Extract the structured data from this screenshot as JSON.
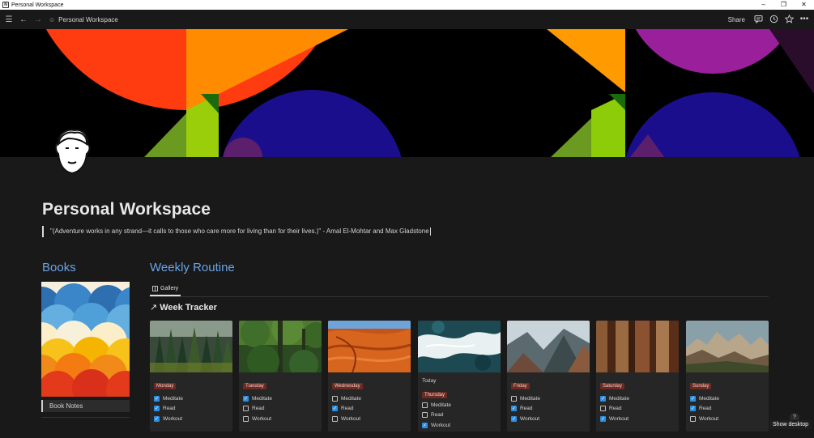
{
  "window": {
    "title": "Personal Workspace",
    "controls": {
      "minimize": "–",
      "restore": "❐",
      "close": "✕"
    }
  },
  "toolbar": {
    "breadcrumb": "Personal Workspace",
    "share_label": "Share"
  },
  "page": {
    "title": "Personal Workspace",
    "quote": "\"(Adventure works in any strand—it calls to those who care more for living than for their lives.)\" - Amal El-Mohtar and Max Gladstone"
  },
  "books": {
    "heading": "Books",
    "card_title": "Book Notes"
  },
  "weekly": {
    "heading": "Weekly Routine",
    "view_tab": "Gallery",
    "tracker_title": "Week Tracker",
    "cards": [
      {
        "day": "Monday",
        "today": "",
        "tasks": [
          {
            "label": "Meditate",
            "done": true
          },
          {
            "label": "Read",
            "done": true
          },
          {
            "label": "Workout",
            "done": true
          }
        ]
      },
      {
        "day": "Tuesday",
        "today": "",
        "tasks": [
          {
            "label": "Meditate",
            "done": true
          },
          {
            "label": "Read",
            "done": false
          },
          {
            "label": "Workout",
            "done": false
          }
        ]
      },
      {
        "day": "Wednesday",
        "today": "",
        "tasks": [
          {
            "label": "Meditate",
            "done": false
          },
          {
            "label": "Read",
            "done": true
          },
          {
            "label": "Workout",
            "done": false
          }
        ]
      },
      {
        "day": "Thursday",
        "today": "Today",
        "tasks": [
          {
            "label": "Meditate",
            "done": false
          },
          {
            "label": "Read",
            "done": false
          },
          {
            "label": "Workout",
            "done": true
          }
        ]
      },
      {
        "day": "Friday",
        "today": "",
        "tasks": [
          {
            "label": "Meditate",
            "done": false
          },
          {
            "label": "Read",
            "done": true
          },
          {
            "label": "Workout",
            "done": true
          }
        ]
      },
      {
        "day": "Saturday",
        "today": "",
        "tasks": [
          {
            "label": "Meditate",
            "done": true
          },
          {
            "label": "Read",
            "done": false
          },
          {
            "label": "Workout",
            "done": true
          }
        ]
      },
      {
        "day": "Sunday",
        "today": "",
        "tasks": [
          {
            "label": "Meditate",
            "done": true
          },
          {
            "label": "Read",
            "done": true
          },
          {
            "label": "Workout",
            "done": false
          }
        ]
      }
    ]
  },
  "taskbar": {
    "show_desktop": "Show desktop",
    "help": "?"
  },
  "colors": {
    "background": "#191919",
    "heading_blue": "#6aa4e6",
    "tag_red": "#6b2b22",
    "checkbox_blue": "#2f8fdf"
  }
}
